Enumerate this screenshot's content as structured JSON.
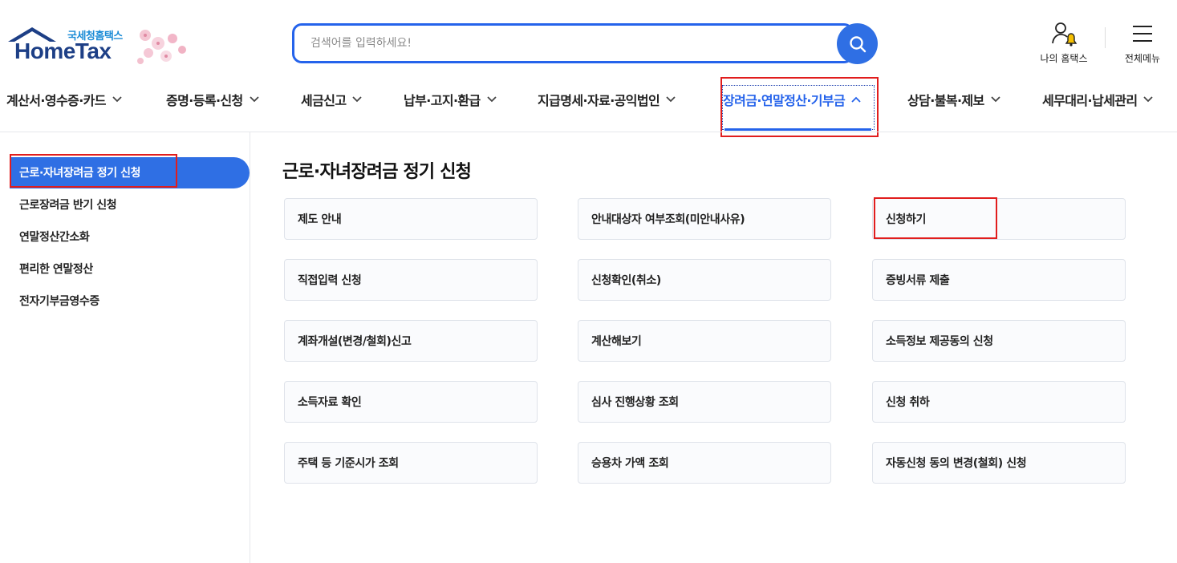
{
  "header": {
    "logo_sub": "국세청홈택스",
    "logo_main": "HomeTax",
    "search_placeholder": "검색어를 입력하세요!",
    "my_home_label": "나의 홈택스",
    "all_menu_label": "전체메뉴"
  },
  "gnb": {
    "items": [
      {
        "label": "계산서·영수증·카드"
      },
      {
        "label": "증명·등록·신청"
      },
      {
        "label": "세금신고"
      },
      {
        "label": "납부·고지·환급"
      },
      {
        "label": "지급명세·자료·공익법인"
      },
      {
        "label": "장려금·연말정산·기부금",
        "active": true
      },
      {
        "label": "상담·불복·제보"
      },
      {
        "label": "세무대리·납세관리"
      }
    ]
  },
  "sidebar": {
    "items": [
      {
        "label": "근로·자녀장려금 정기 신청",
        "active": true
      },
      {
        "label": "근로장려금 반기 신청"
      },
      {
        "label": "연말정산간소화"
      },
      {
        "label": "편리한 연말정산"
      },
      {
        "label": "전자기부금영수증"
      }
    ]
  },
  "main": {
    "title": "근로·자녀장려금 정기 신청",
    "cards": [
      "제도 안내",
      "안내대상자 여부조회(미안내사유)",
      "신청하기",
      "직접입력 신청",
      "신청확인(취소)",
      "증빙서류 제출",
      "계좌개설(변경/철회)신고",
      "계산해보기",
      "소득정보 제공동의 신청",
      "소득자료 확인",
      "심사 진행상황 조회",
      "신청 취하",
      "주택 등 기준시가 조회",
      "승용차 가액 조회",
      "자동신청 동의 변경(철회) 신청"
    ]
  },
  "colors": {
    "accent": "#2563eb",
    "active_bg": "#2f6fe4",
    "highlight": "#e11d1d",
    "logo_navy": "#1d3f86",
    "logo_sub": "#1a8bd6"
  }
}
